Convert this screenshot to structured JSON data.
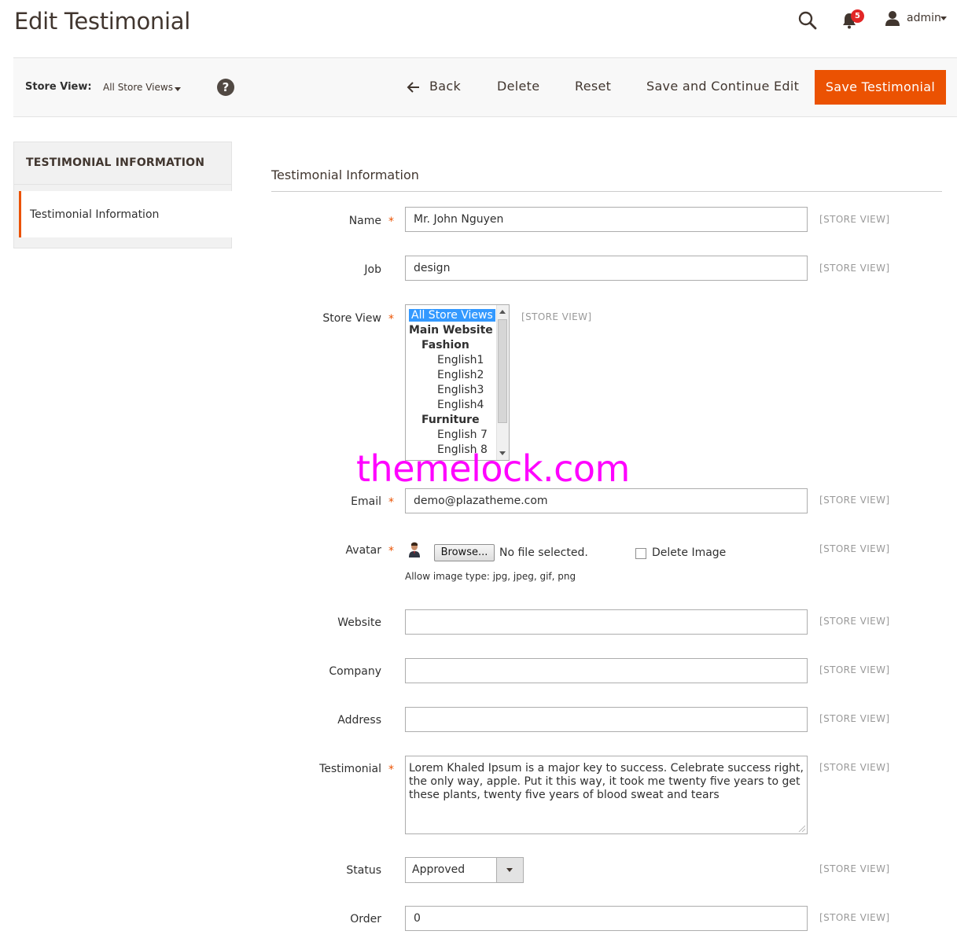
{
  "page": {
    "title": "Edit Testimonial"
  },
  "header": {
    "notifications_count": "5",
    "username": "admin",
    "icons": [
      "search-icon",
      "bell-icon",
      "user-icon",
      "chevron-down-icon"
    ]
  },
  "toolbar": {
    "store_view_label": "Store View:",
    "store_view_value": "All Store Views",
    "help": "?",
    "back": "Back",
    "delete": "Delete",
    "reset": "Reset",
    "save_continue": "Save and Continue Edit",
    "save": "Save Testimonial"
  },
  "tabs": {
    "title": "TESTIMONIAL INFORMATION",
    "items": [
      {
        "label": "Testimonial Information"
      }
    ]
  },
  "form": {
    "section_title": "Testimonial Information",
    "scope_label": "[STORE VIEW]",
    "required_mark": "*",
    "fields": {
      "name": {
        "label": "Name",
        "value": "Mr. John Nguyen"
      },
      "job": {
        "label": "Job",
        "value": "design"
      },
      "store_view": {
        "label": "Store View",
        "options": [
          {
            "text": "All Store Views",
            "selected": true
          },
          {
            "text": "Main Website"
          },
          {
            "text": "Fashion"
          },
          {
            "text": "English1"
          },
          {
            "text": "English2"
          },
          {
            "text": "English3"
          },
          {
            "text": "English4"
          },
          {
            "text": "Furniture"
          },
          {
            "text": "English 7"
          },
          {
            "text": "English 8"
          }
        ]
      },
      "email": {
        "label": "Email",
        "value": "demo@plazatheme.com"
      },
      "avatar": {
        "label": "Avatar",
        "browse": "Browse...",
        "no_file": "No file selected.",
        "delete_image": "Delete Image",
        "note": "Allow image type: jpg, jpeg, gif, png"
      },
      "website": {
        "label": "Website",
        "value": ""
      },
      "company": {
        "label": "Company",
        "value": ""
      },
      "address": {
        "label": "Address",
        "value": ""
      },
      "testimonial": {
        "label": "Testimonial",
        "value": "Lorem Khaled Ipsum is a major key to success. Celebrate success right, the only way, apple. Put it this way, it took me twenty five years to get these plants, twenty five years of blood sweat and tears"
      },
      "status": {
        "label": "Status",
        "value": "Approved"
      },
      "order": {
        "label": "Order",
        "value": "0"
      }
    }
  },
  "watermark": "themelock.com",
  "colors": {
    "accent": "#eb5202",
    "badge": "#e22626",
    "selection": "#3399ff",
    "watermark": "#ff00ff"
  }
}
